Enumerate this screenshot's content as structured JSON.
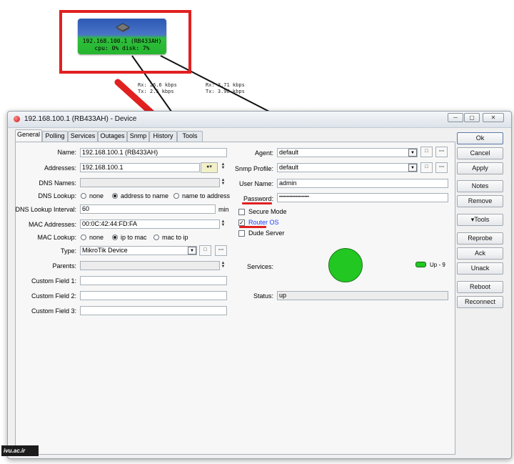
{
  "map": {
    "node_title": "192.168.100.1 (RB433AH)",
    "node_stats": "cpu: 0% disk: 7%",
    "link1_traffic": "Rx: 26.6 kbps\nTx: 2.5 kbps",
    "link2_traffic": "Rx: 3.71 kbps\nTx: 3.98 kbps"
  },
  "window": {
    "title": "192.168.100.1 (RB433AH) - Device",
    "tabs": [
      "General",
      "Polling",
      "Services",
      "Outages",
      "Snmp",
      "History",
      "Tools"
    ],
    "active_tab": "General"
  },
  "general": {
    "name_label": "Name:",
    "name_value": "192.168.100.1 (RB433AH)",
    "addresses_label": "Addresses:",
    "addresses_value": "192.168.100.1",
    "dns_names_label": "DNS Names:",
    "dns_names_value": "",
    "dns_lookup_label": "DNS Lookup:",
    "dns_lookup_options": [
      "none",
      "address to name",
      "name to address"
    ],
    "dns_lookup_selected": "address to name",
    "dns_interval_label": "DNS Lookup Interval:",
    "dns_interval_value": "60",
    "dns_interval_unit": "min",
    "mac_label": "MAC Addresses:",
    "mac_value": "00:0C:42:44:FD:FA",
    "mac_lookup_label": "MAC Lookup:",
    "mac_lookup_options": [
      "none",
      "ip to mac",
      "mac to ip"
    ],
    "mac_lookup_selected": "ip to mac",
    "type_label": "Type:",
    "type_value": "MikroTik Device",
    "parents_label": "Parents:",
    "parents_value": "",
    "custom1_label": "Custom Field 1:",
    "custom2_label": "Custom Field 2:",
    "custom3_label": "Custom Field 3:",
    "custom1_value": "",
    "custom2_value": "",
    "custom3_value": ""
  },
  "right": {
    "agent_label": "Agent:",
    "agent_value": "default",
    "snmp_profile_label": "Snmp Profile:",
    "snmp_profile_value": "default",
    "user_name_label": "User Name:",
    "user_name_value": "admin",
    "password_label": "Password:",
    "password_value": "••••••••••••••••••••",
    "secure_mode_label": "Secure Mode",
    "secure_mode_checked": false,
    "router_os_label": "Router OS",
    "router_os_checked": true,
    "dude_server_label": "Dude Server",
    "dude_server_checked": false,
    "services_label": "Services:",
    "services_legend": "Up - 9",
    "status_label": "Status:",
    "status_value": "up"
  },
  "buttons": [
    "Ok",
    "Cancel",
    "Apply",
    "Notes",
    "Remove",
    "▾Tools",
    "Reprobe",
    "Ack",
    "Unack",
    "Reboot",
    "Reconnect"
  ],
  "watermark": "ivu.ac.ir",
  "colors": {
    "service_up": "#22c722",
    "annotation_red": "#e12020",
    "link_blue": "#1a3cff"
  }
}
